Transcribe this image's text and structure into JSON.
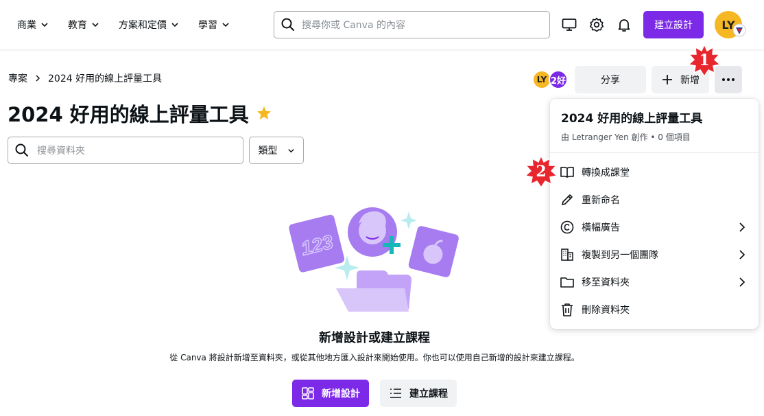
{
  "nav": {
    "items": [
      {
        "label": "商業"
      },
      {
        "label": "教育"
      },
      {
        "label": "方案和定價"
      },
      {
        "label": "學習"
      }
    ],
    "search_placeholder": "搜尋你或 Canva 的內容",
    "create_button": "建立設計",
    "user_initials": "LY"
  },
  "breadcrumb": {
    "root": "專案",
    "current": "2024 好用的線上評量工具"
  },
  "page": {
    "title": "2024 好用的線上評量工具",
    "collaborators": [
      "LY",
      "2好"
    ],
    "share_button": "分享",
    "new_button": "新增",
    "folder_search_placeholder": "搜尋資料夾",
    "type_filter": "類型"
  },
  "empty_state": {
    "title": "新增設計或建立課程",
    "description": "從 Canva 將設計新增至資料夾，或從其他地方匯入設計來開始使用。你也可以使用自己新增的設計來建立課程。",
    "new_design_button": "新增設計",
    "create_course_button": "建立課程",
    "illustration_text": "123"
  },
  "menu": {
    "title": "2024 好用的線上評量工具",
    "subtitle": "由 Letranger Yen 創作 • 0 個項目",
    "items": [
      {
        "label": "轉換成課堂",
        "icon": "open-book-icon",
        "submenu": false
      },
      {
        "label": "重新命名",
        "icon": "pencil-icon",
        "submenu": false
      },
      {
        "label": "橫幅廣告",
        "icon": "copyright-icon",
        "submenu": true
      },
      {
        "label": "複製到另一個團隊",
        "icon": "building-icon",
        "submenu": true
      },
      {
        "label": "移至資料夾",
        "icon": "folder-icon",
        "submenu": true
      },
      {
        "label": "刪除資料夾",
        "icon": "trash-icon",
        "submenu": false
      }
    ]
  },
  "callouts": [
    {
      "number": "1"
    },
    {
      "number": "2"
    }
  ],
  "colors": {
    "brand_purple": "#7d2ae8",
    "avatar_yellow": "#f5b722",
    "callout_red": "#e8262e"
  }
}
